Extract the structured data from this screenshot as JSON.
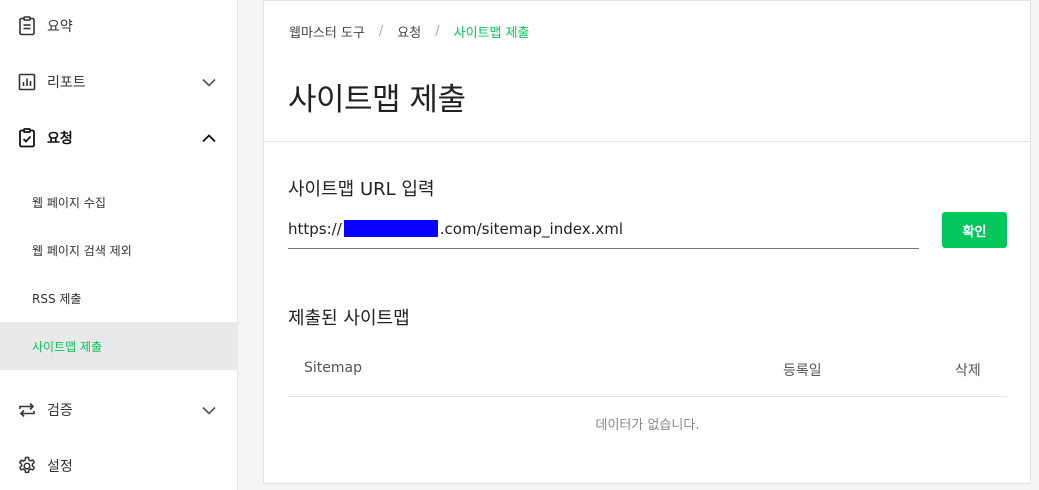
{
  "sidebar": {
    "items": [
      {
        "label": "요약",
        "icon": "document-icon"
      },
      {
        "label": "리포트",
        "icon": "bar-chart-icon",
        "expanded": false
      },
      {
        "label": "요청",
        "icon": "check-clipboard-icon",
        "expanded": true
      },
      {
        "label": "검증",
        "icon": "repeat-icon",
        "expanded": false
      },
      {
        "label": "설정",
        "icon": "gear-icon"
      }
    ],
    "sub_items": [
      {
        "label": "웹 페이지 수집"
      },
      {
        "label": "웹 페이지 검색 제외"
      },
      {
        "label": "RSS 제출"
      },
      {
        "label": "사이트맵 제출",
        "selected": true
      }
    ]
  },
  "breadcrumb": {
    "items": [
      "웹마스터 도구",
      "요청",
      "사이트맵 제출"
    ],
    "separator": "/"
  },
  "page_title": "사이트맵 제출",
  "url_section": {
    "title": "사이트맵 URL 입력",
    "value_prefix": "https://",
    "value_suffix": ".com/sitemap_index.xml",
    "confirm_label": "확인"
  },
  "submitted_section": {
    "title": "제출된 사이트맵",
    "columns": [
      "Sitemap",
      "등록일",
      "삭제"
    ],
    "empty_message": "데이터가 없습니다."
  },
  "colors": {
    "accent": "#03c75a",
    "redaction": "#0a00ff"
  }
}
